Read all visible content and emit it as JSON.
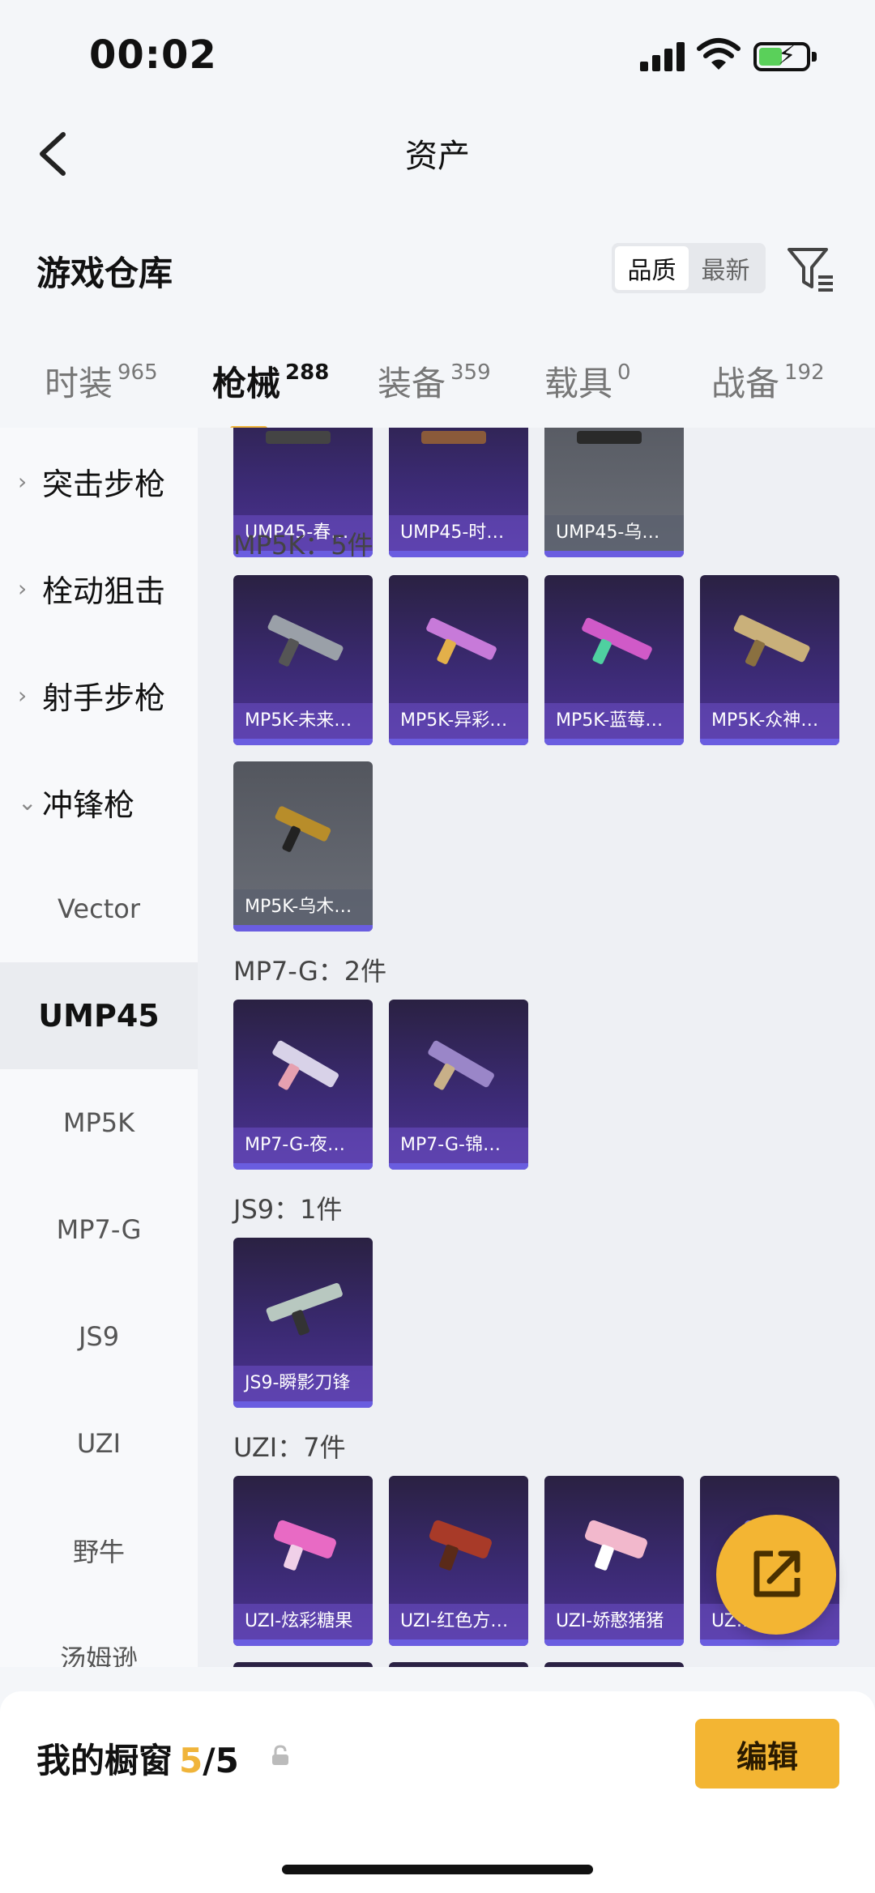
{
  "status_bar": {
    "time": "00:02"
  },
  "header": {
    "title": "资产"
  },
  "toolbar": {
    "title": "游戏仓库",
    "sort_options": [
      "品质",
      "最新"
    ],
    "sort_selected": "品质"
  },
  "tabs": [
    {
      "label": "时装",
      "count": "965"
    },
    {
      "label": "枪械",
      "count": "288"
    },
    {
      "label": "装备",
      "count": "359"
    },
    {
      "label": "载具",
      "count": "0"
    },
    {
      "label": "战备",
      "count": "192"
    }
  ],
  "sidebar": {
    "categories": [
      "突击步枪",
      "栓动狙击",
      "射手步枪",
      "冲锋枪"
    ],
    "subs": [
      "Vector",
      "UMP45",
      "MP5K",
      "MP7-G",
      "JS9",
      "UZI",
      "野牛",
      "汤姆逊"
    ]
  },
  "content": {
    "top_row": [
      "UMP45-春…",
      "UMP45-时…",
      "UMP45-乌…"
    ],
    "groups": [
      {
        "title": "MP5K：5件",
        "items": [
          "MP5K-未来…",
          "MP5K-异彩…",
          "MP5K-蓝莓…",
          "MP5K-众神…",
          "MP5K-乌木…"
        ]
      },
      {
        "title": "MP7-G：2件",
        "items": [
          "MP7-G-夜…",
          "MP7-G-锦…"
        ]
      },
      {
        "title": "JS9：1件",
        "items": [
          "JS9-瞬影刀锋"
        ]
      },
      {
        "title": "UZI：7件",
        "items": [
          "UZI-炫彩糖果",
          "UZI-红色方…",
          "UZI-娇憨猪猪",
          "UZ…美"
        ]
      }
    ]
  },
  "bottom": {
    "label": "我的橱窗",
    "current": "5",
    "total": "/5",
    "edit_label": "编辑"
  },
  "colors": {
    "accent": "#f3b533",
    "card_purple": "#3b2a73",
    "card_gray": "#6b6f78"
  }
}
